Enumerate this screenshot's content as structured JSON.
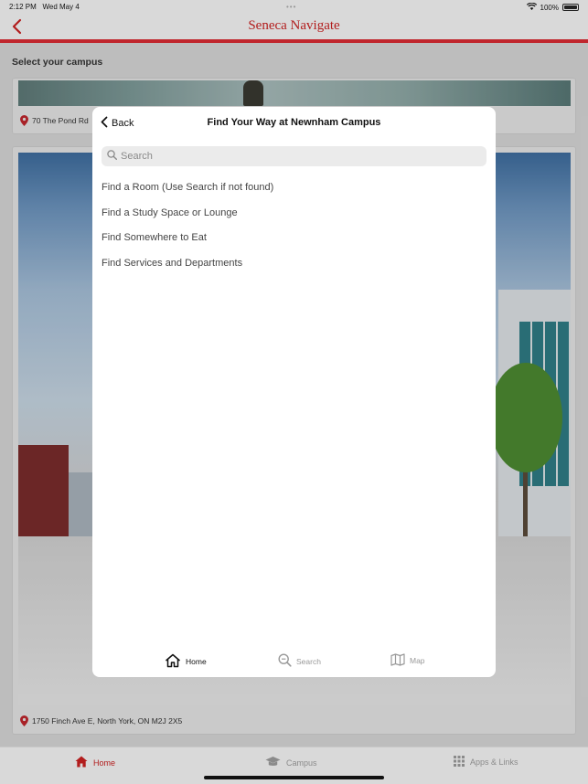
{
  "status_bar": {
    "time": "2:12 PM",
    "date": "Wed May 4",
    "battery": "100%"
  },
  "nav": {
    "title": "Seneca Navigate",
    "back_icon": "chevron-left-icon"
  },
  "page": {
    "section_title": "Select your campus"
  },
  "campuses": [
    {
      "address": "70 The Pond Rd"
    },
    {
      "address": "1750 Finch Ave E, North York, ON M2J 2X5"
    }
  ],
  "modal": {
    "back_label": "Back",
    "title": "Find Your Way at Newnham Campus",
    "search_placeholder": "Search",
    "menu_items": [
      "Find a Room (Use Search if not found)",
      "Find a Study Space or Lounge",
      "Find Somewhere to Eat",
      "Find Services and Departments"
    ],
    "tabs": [
      {
        "label": "Home",
        "icon": "home-icon",
        "active": true
      },
      {
        "label": "Search",
        "icon": "search-icon",
        "active": false
      },
      {
        "label": "Map",
        "icon": "map-icon",
        "active": false
      }
    ]
  },
  "tab_bar": [
    {
      "label": "Home",
      "icon": "home-icon",
      "active": true
    },
    {
      "label": "Campus",
      "icon": "graduation-cap-icon",
      "active": false
    },
    {
      "label": "Apps & Links",
      "icon": "grid-icon",
      "active": false
    }
  ],
  "colors": {
    "brand_red": "#b21d1d",
    "accent_bar": "#c0262d"
  }
}
